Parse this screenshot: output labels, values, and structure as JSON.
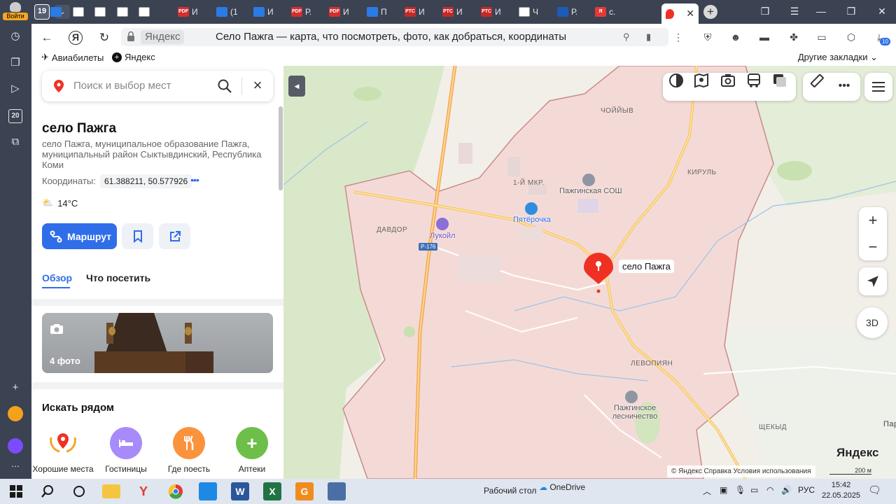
{
  "browser": {
    "login_label": "Войти",
    "tab_count": "19",
    "tabs": [
      {
        "label": "",
        "color": "#2b7be4",
        "fav": ""
      },
      {
        "label": "",
        "color": "#ffffff",
        "fav": ""
      },
      {
        "label": "",
        "color": "#ffffff",
        "fav": ""
      },
      {
        "label": "",
        "color": "#ffffff",
        "fav": ""
      },
      {
        "label": "",
        "color": "#ffffff",
        "fav": ""
      },
      {
        "label": "И",
        "color": "#d32f2f",
        "fav": "PDF"
      },
      {
        "label": "(1",
        "color": "#2b7be4",
        "fav": ""
      },
      {
        "label": "И",
        "color": "#2b7be4",
        "fav": ""
      },
      {
        "label": "Р.",
        "color": "#d32f2f",
        "fav": "PDF"
      },
      {
        "label": "И",
        "color": "#d32f2f",
        "fav": "PDF"
      },
      {
        "label": "П",
        "color": "#2b7be4",
        "fav": ""
      },
      {
        "label": "И",
        "color": "#c62828",
        "fav": "РТС"
      },
      {
        "label": "И",
        "color": "#c62828",
        "fav": "РТС"
      },
      {
        "label": "И",
        "color": "#c62828",
        "fav": "РТС"
      },
      {
        "label": "Ч",
        "color": "#ffffff",
        "fav": ""
      },
      {
        "label": "Р.",
        "color": "#1e5bb8",
        "fav": ""
      },
      {
        "label": "с.",
        "color": "#e53935",
        "fav": "Я"
      }
    ],
    "active_tab_label": "",
    "url_site": "Яндекс",
    "page_title": "Село Пажга — карта, что посмотреть, фото, как добраться, координаты",
    "downloads_badge": "10",
    "bookmarks": [
      {
        "label": "Авиабилеты"
      },
      {
        "label": "Яндекс"
      }
    ],
    "other_bookmarks": "Другие закладки"
  },
  "panel": {
    "search_placeholder": "Поиск и выбор мест",
    "place_title": "село Пажга",
    "place_address": "село Пажга, муниципальное образование Пажга, муниципальный район Сыктывдинский, Республика Коми",
    "coords_label": "Координаты:",
    "coords_value": "61.388211, 50.577926",
    "weather": "14°C",
    "route_label": "Маршрут",
    "tabs": {
      "overview": "Обзор",
      "visit": "Что посетить"
    },
    "photo_count": "4 фото",
    "nearby_title": "Искать рядом",
    "categories": [
      {
        "label": "Хорошие места",
        "color": "#ffffff"
      },
      {
        "label": "Гостиницы",
        "color": "#a78bfa"
      },
      {
        "label": "Где поесть",
        "color": "#fb923c"
      },
      {
        "label": "Аптеки",
        "color": "#6dbf4a"
      }
    ]
  },
  "map": {
    "marker_label": "село Пажга",
    "labels": {
      "choiyv": "ЧОЙЙЫВ",
      "kirul": "КИРУЛЬ",
      "mkr": "1-Й МКР.",
      "davdor": "ДАВДОР",
      "levopiyan": "ЛЕВОПИЯН",
      "shchekyd": "ЩЕКЫД",
      "par": "Пар"
    },
    "pois": {
      "school": "Пажгинская СОШ",
      "pyaterochka": "Пятёрочка",
      "lukoil": "Лукойл",
      "forestry": "Пажгинское лесничество"
    },
    "road_sign": "Р-176",
    "logo": "Яндекс",
    "copyright": "© Яндекс   Справка   Условия использования",
    "scale": "200 м",
    "btn_3d": "3D"
  },
  "taskbar": {
    "desktop_label": "Рабочий стол",
    "onedrive_label": "OneDrive",
    "lang": "РУС",
    "time": "15:42",
    "date": "22.05.2025"
  }
}
